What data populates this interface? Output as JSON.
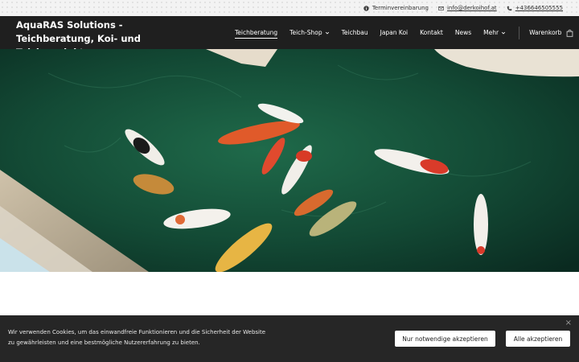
{
  "topbar": {
    "appointment": "Terminvereinbarung",
    "email": "info@derkoihof.at",
    "phone": "+436646505555"
  },
  "header": {
    "brand": "AquaRAS Solutions - Teichberatung, Koi- und Teichprodukte",
    "nav": {
      "teichberatung": "Teichberatung",
      "teichshop": "Teich-Shop",
      "teichbau": "Teichbau",
      "japankoi": "Japan Koi",
      "kontakt": "Kontakt",
      "news": "News",
      "mehr": "Mehr",
      "warenkorb": "Warenkorb"
    }
  },
  "cookie": {
    "text": "Wir verwenden Cookies, um das einwandfreie Funktionieren und die Sicherheit der Website zu gewährleisten und eine bestmögliche Nutzererfahrung zu bieten.",
    "necessary_label": "Nur notwendige akzeptieren",
    "accept_all_label": "Alle akzeptieren",
    "close": "×"
  },
  "icons": {
    "appointment": "info-circle-icon",
    "email": "envelope-icon",
    "phone": "phone-icon",
    "cart": "shopping-bag-icon",
    "dropdown": "chevron-down-icon"
  }
}
